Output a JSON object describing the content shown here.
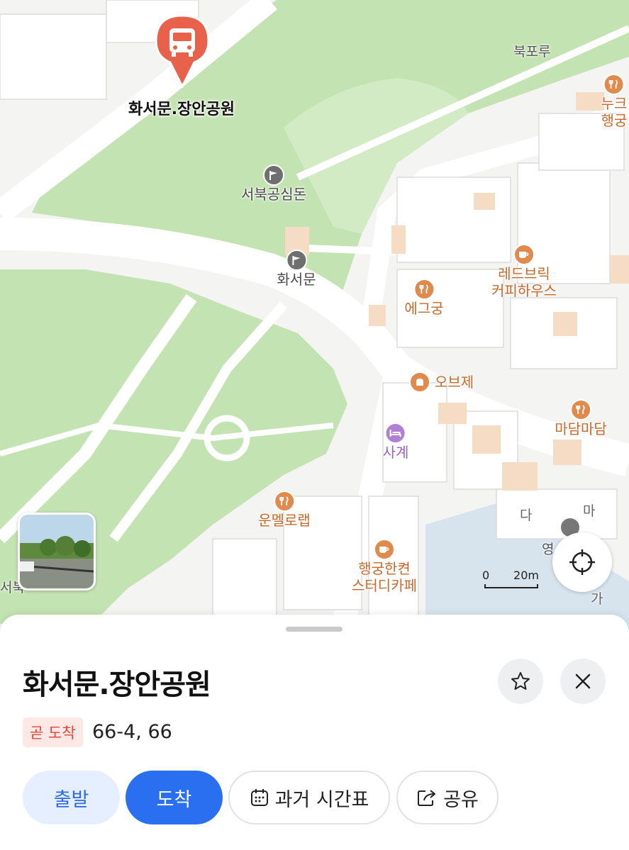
{
  "map": {
    "stop_marker_label": "화서문.장안공원",
    "road_label": "북포루",
    "pois": [
      {
        "name": "서북공심돈",
        "kind": "landmark"
      },
      {
        "name": "화서문",
        "kind": "landmark"
      },
      {
        "name": "에그궁",
        "kind": "restaurant"
      },
      {
        "name": "레드브릭\n커피하우스",
        "kind": "cafe"
      },
      {
        "name": "오브제",
        "kind": "bakery"
      },
      {
        "name": "사계",
        "kind": "lodging"
      },
      {
        "name": "마담마담",
        "kind": "restaurant"
      },
      {
        "name": "운멜로랩",
        "kind": "restaurant"
      },
      {
        "name": "행궁한켠\n스터디카페",
        "kind": "cafe"
      },
      {
        "name": "누크\n행궁",
        "kind": "restaurant"
      }
    ],
    "edge_fragments": [
      "다",
      "마",
      "영",
      "가",
      "서북"
    ],
    "scale": {
      "zero": "0",
      "distance": "20m"
    },
    "colors": {
      "park": "#c4e3b3",
      "road": "#ffffff",
      "poi_orange": "#e08a4e",
      "landmark_gray": "#6f6f6f",
      "lodging_purple": "#b17fd4",
      "bus_marker": "#e8624b"
    }
  },
  "sheet": {
    "title": "화서문.장안공원",
    "status_badge": "곧 도착",
    "routes": "66-4, 66",
    "actions": {
      "depart": "출발",
      "arrive": "도착",
      "timetable": "과거 시간표",
      "share": "공유"
    }
  }
}
